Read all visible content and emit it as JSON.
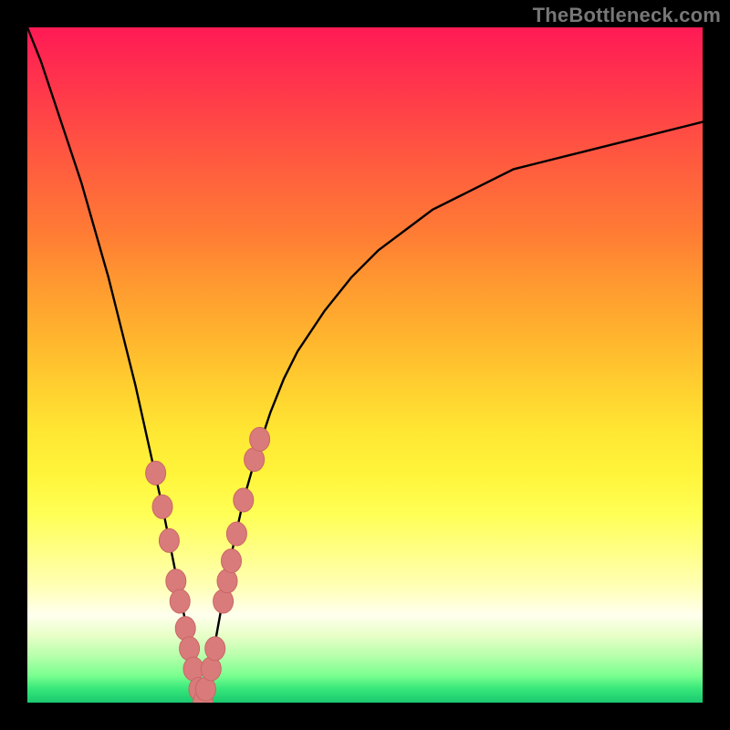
{
  "domain": "Chart",
  "watermark": "TheBottleneck.com",
  "colors": {
    "curve": "#000000",
    "marker_fill": "#da7b7b",
    "marker_stroke": "#c96666",
    "frame_bg": "#000000"
  },
  "chart_data": {
    "type": "line",
    "title": "",
    "xlabel": "",
    "ylabel": "",
    "xlim": [
      0,
      100
    ],
    "ylim": [
      0,
      100
    ],
    "x": [
      0,
      2,
      4,
      6,
      8,
      10,
      12,
      14,
      16,
      18,
      20,
      21,
      22,
      23,
      24,
      25,
      26,
      27,
      28,
      30,
      32,
      34,
      36,
      38,
      40,
      44,
      48,
      52,
      56,
      60,
      64,
      68,
      72,
      76,
      80,
      84,
      88,
      92,
      96,
      100
    ],
    "values": [
      100,
      95,
      89,
      83,
      77,
      70,
      63,
      55,
      47,
      38,
      29,
      24,
      19,
      14,
      9,
      4,
      0,
      4,
      10,
      21,
      30,
      37,
      43,
      48,
      52,
      58,
      63,
      67,
      70,
      73,
      75,
      77,
      79,
      80,
      81,
      82,
      83,
      84,
      85,
      86
    ],
    "series": [
      {
        "name": "bottleneck-curve",
        "x": [
          0,
          2,
          4,
          6,
          8,
          10,
          12,
          14,
          16,
          18,
          20,
          21,
          22,
          23,
          24,
          25,
          26,
          27,
          28,
          30,
          32,
          34,
          36,
          38,
          40,
          44,
          48,
          52,
          56,
          60,
          64,
          68,
          72,
          76,
          80,
          84,
          88,
          92,
          96,
          100
        ],
        "y": [
          100,
          95,
          89,
          83,
          77,
          70,
          63,
          55,
          47,
          38,
          29,
          24,
          19,
          14,
          9,
          4,
          0,
          4,
          10,
          21,
          30,
          37,
          43,
          48,
          52,
          58,
          63,
          67,
          70,
          73,
          75,
          77,
          79,
          80,
          81,
          82,
          83,
          84,
          85,
          86
        ]
      }
    ],
    "markers": {
      "name": "highlight-points",
      "points": [
        {
          "x": 19,
          "y": 34
        },
        {
          "x": 20,
          "y": 29
        },
        {
          "x": 21,
          "y": 24
        },
        {
          "x": 22,
          "y": 18
        },
        {
          "x": 22.6,
          "y": 15
        },
        {
          "x": 23.4,
          "y": 11
        },
        {
          "x": 24,
          "y": 8
        },
        {
          "x": 24.6,
          "y": 5
        },
        {
          "x": 25.4,
          "y": 2
        },
        {
          "x": 26,
          "y": 0
        },
        {
          "x": 26.4,
          "y": 2
        },
        {
          "x": 27.2,
          "y": 5
        },
        {
          "x": 27.8,
          "y": 8
        },
        {
          "x": 29,
          "y": 15
        },
        {
          "x": 29.6,
          "y": 18
        },
        {
          "x": 30.2,
          "y": 21
        },
        {
          "x": 31,
          "y": 25
        },
        {
          "x": 32,
          "y": 30
        },
        {
          "x": 33.6,
          "y": 36
        },
        {
          "x": 34.4,
          "y": 39
        }
      ]
    },
    "grid": false,
    "legend": false
  }
}
